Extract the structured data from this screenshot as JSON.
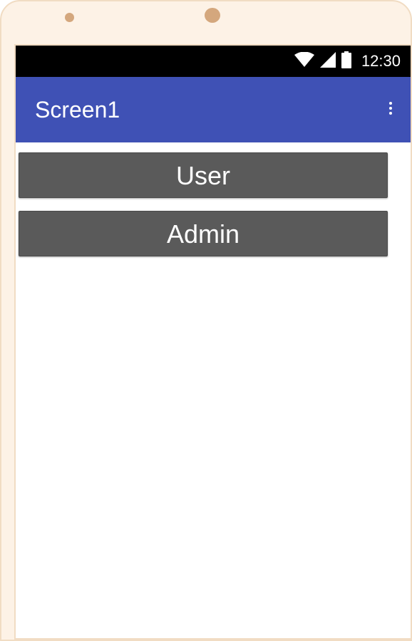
{
  "device": {
    "frame_color": "#fdf2e6",
    "camera_color": "#d4a77d"
  },
  "status_bar": {
    "time": "12:30",
    "icons": [
      "wifi-icon",
      "signal-icon",
      "battery-icon"
    ],
    "background": "#000000"
  },
  "app_bar": {
    "title": "Screen1",
    "background": "#3f51b5",
    "menu_icon": "overflow-menu-icon"
  },
  "buttons": {
    "user_label": "User",
    "admin_label": "Admin",
    "background": "#5a5a5a"
  }
}
